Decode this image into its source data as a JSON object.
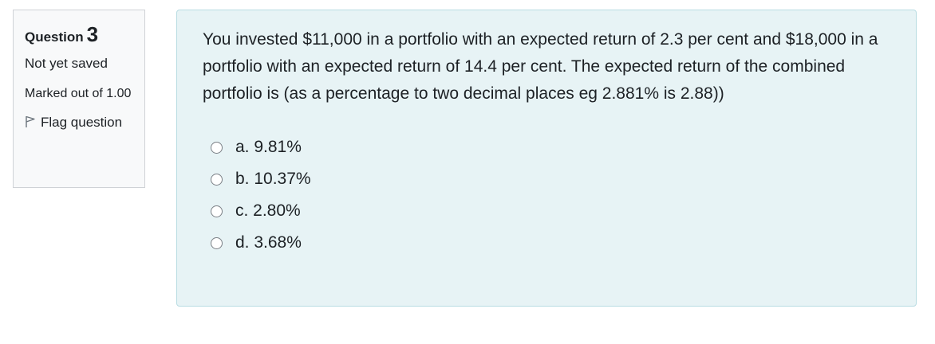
{
  "question": {
    "label": "Question",
    "number": "3",
    "state": "Not yet saved",
    "grade": "Marked out of 1.00",
    "flag_label": "Flag question",
    "flag_icon": "flag-outline-icon"
  },
  "content": {
    "text": "You invested $11,000 in a portfolio with an expected return of 2.3 per cent and $18,000 in a portfolio with an expected return of 14.4 per cent. The expected return of the combined portfolio is (as a percentage to two decimal places eg 2.881% is 2.88))",
    "answers": [
      {
        "label": "a. 9.81%"
      },
      {
        "label": "b. 10.37%"
      },
      {
        "label": "c. 2.80%"
      },
      {
        "label": "d. 3.68%"
      }
    ]
  },
  "colors": {
    "info_bg": "#f8f9fa",
    "content_bg": "#e7f3f5",
    "content_border": "#b8dce2"
  }
}
